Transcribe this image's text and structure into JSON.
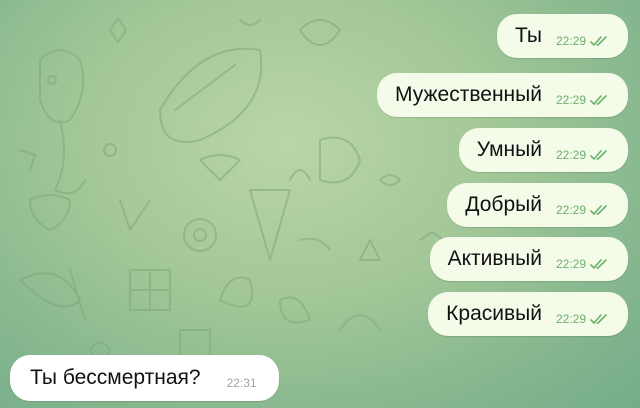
{
  "chat": {
    "outgoing": [
      {
        "text": "Ты",
        "time": "22:29",
        "status_icon": "double-check-icon"
      },
      {
        "text": "Мужественный",
        "time": "22:29",
        "status_icon": "double-check-icon"
      },
      {
        "text": "Умный",
        "time": "22:29",
        "status_icon": "double-check-icon"
      },
      {
        "text": "Добрый",
        "time": "22:29",
        "status_icon": "double-check-icon"
      },
      {
        "text": "Активный",
        "time": "22:29",
        "status_icon": "double-check-icon"
      },
      {
        "text": "Красивый",
        "time": "22:29",
        "status_icon": "double-check-icon"
      }
    ],
    "incoming": [
      {
        "text": "Ты бессмертная?",
        "time": "22:31"
      }
    ]
  },
  "colors": {
    "background": "#a4c898",
    "outgoing_bubble": "#f4fbe9",
    "incoming_bubble": "#ffffff",
    "outgoing_time": "#6bb06c",
    "incoming_time": "#a3a3a3"
  }
}
